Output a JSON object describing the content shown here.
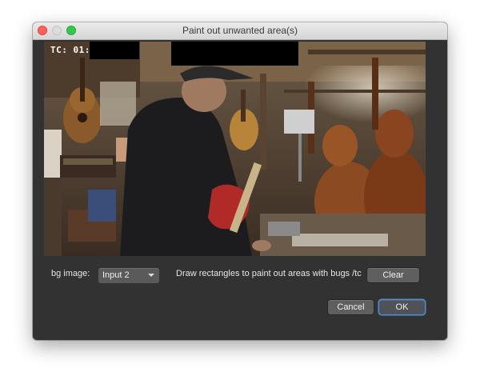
{
  "window": {
    "title": "Paint out unwanted area(s)"
  },
  "viewer": {
    "timecode_label": "TC: 01:",
    "image_description": "video frame of a man playing a red electric guitar in a workshop full of string instruments"
  },
  "controls": {
    "bg_image_label": "bg image:",
    "bg_image_value": "Input 2",
    "instruction": "Draw rectangles to paint out areas with bugs /tc",
    "clear_label": "Clear"
  },
  "footer": {
    "cancel_label": "Cancel",
    "ok_label": "OK"
  },
  "colors": {
    "window_bg": "#323232",
    "default_button_ring": "#4c8ed9"
  }
}
